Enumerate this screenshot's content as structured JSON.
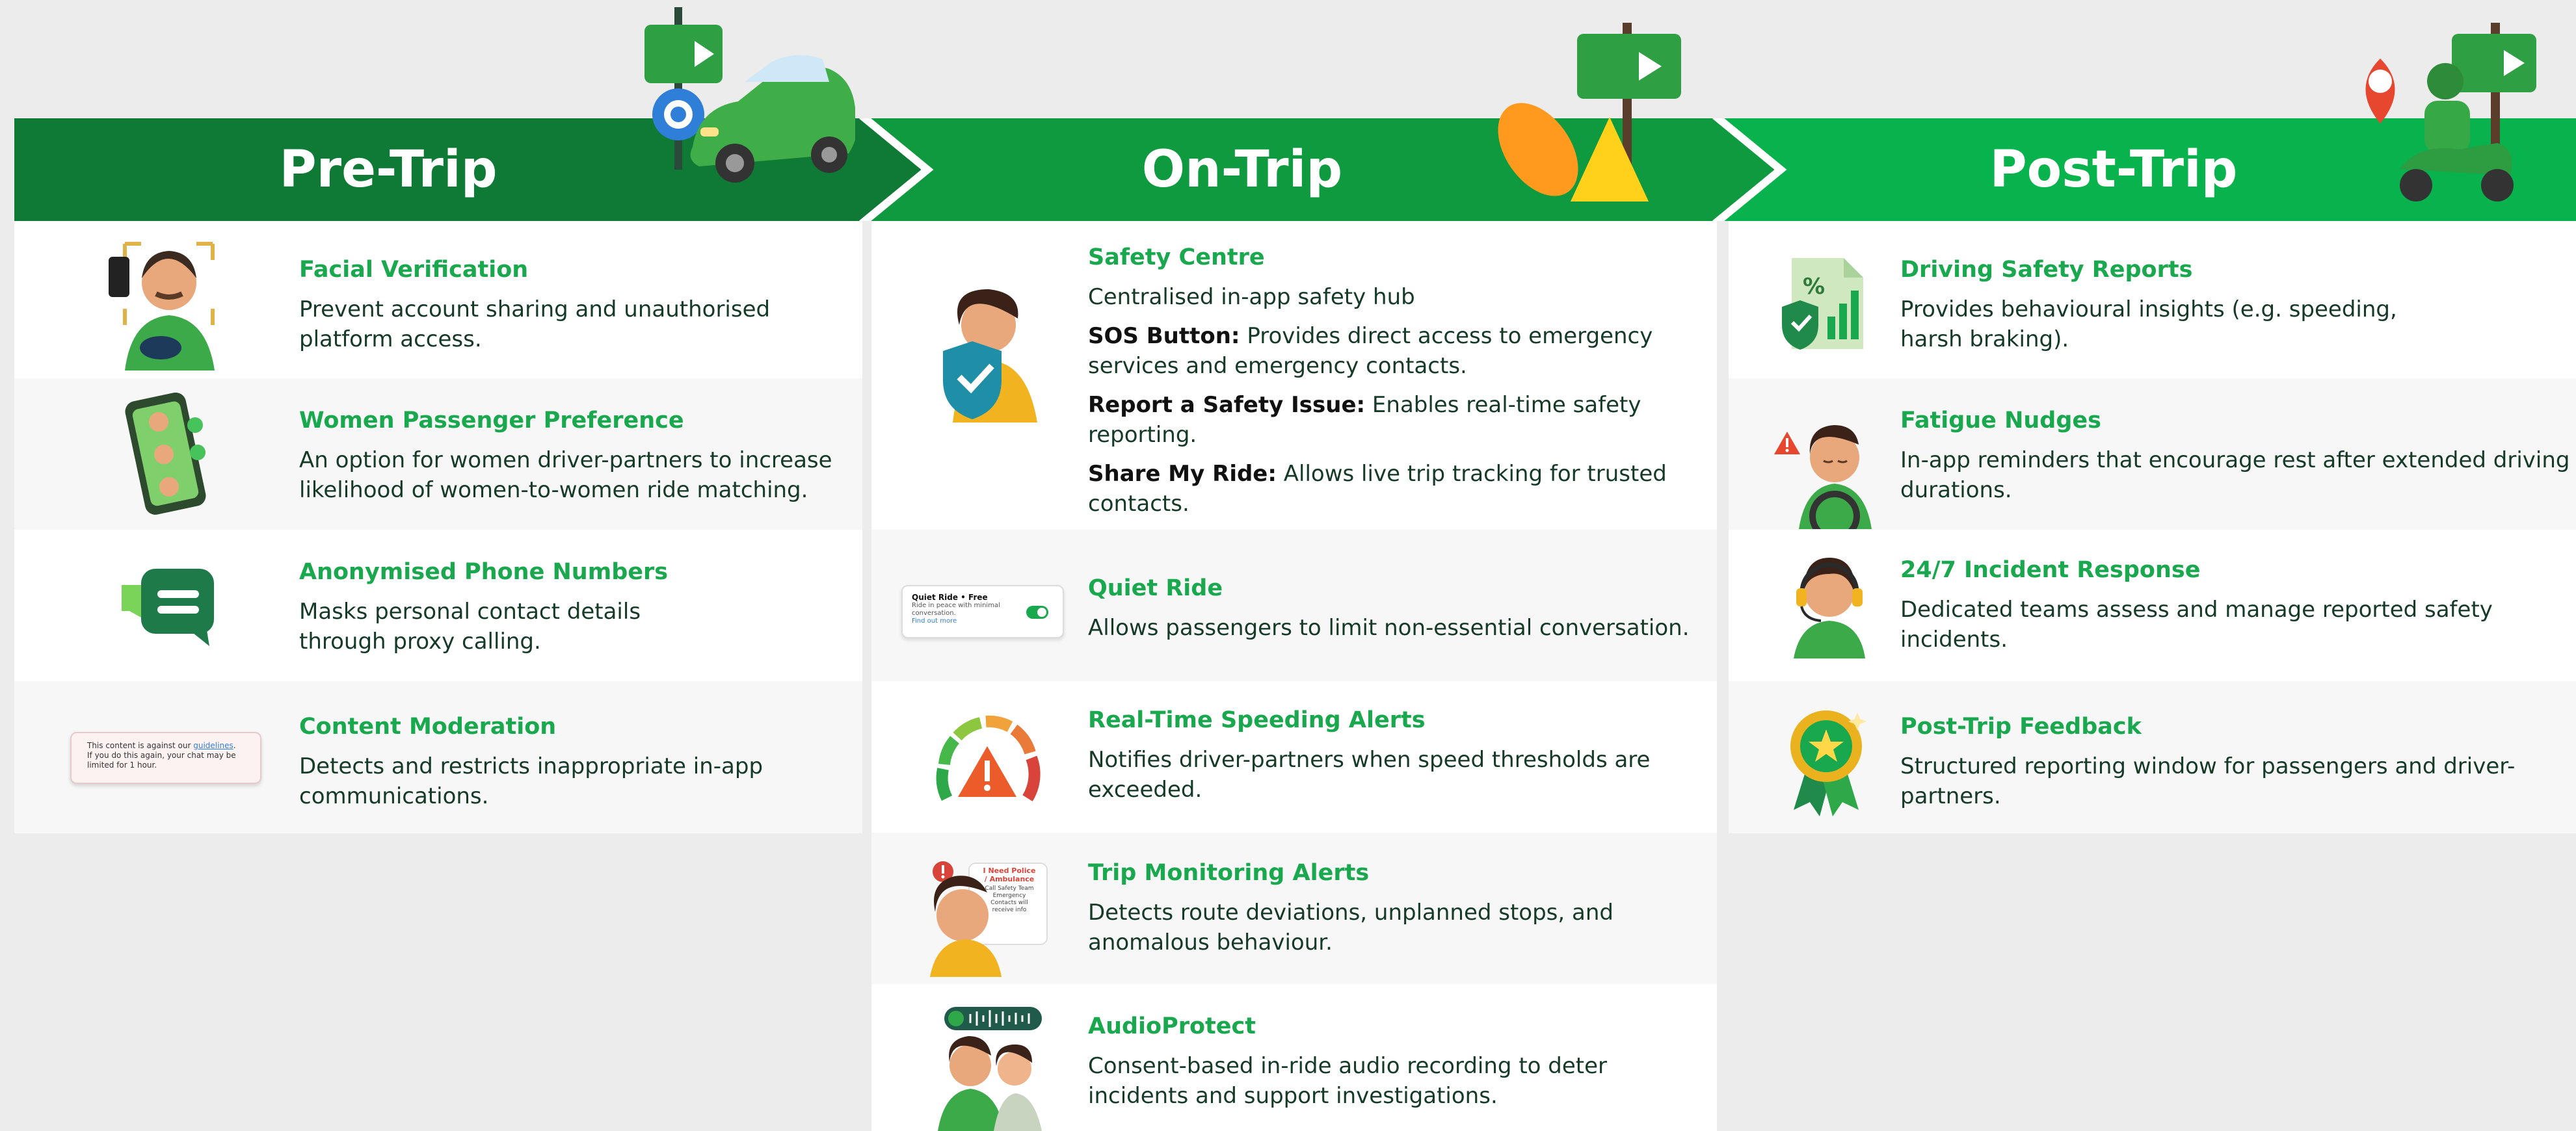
{
  "colors": {
    "pre": "#0e7a35",
    "on": "#0f9a40",
    "post": "#08b24c",
    "title_green": "#1aa84f",
    "text": "#163a28"
  },
  "columns": [
    {
      "title": "Pre-Trip",
      "items": [
        {
          "title": "Facial Verification",
          "lines": [
            "Prevent account sharing and unauthorised",
            "platform access."
          ],
          "icon": "face-scan-person-icon"
        },
        {
          "title": "Women Passenger Preference",
          "lines": [
            "An option for women driver-partners to increase",
            "likelihood of women-to-women ride matching."
          ],
          "icon": "phone-profiles-icon"
        },
        {
          "title": "Anonymised Phone Numbers",
          "lines": [
            "Masks personal contact details",
            "through proxy calling."
          ],
          "icon": "chat-bubble-icon"
        },
        {
          "title": "Content Moderation",
          "lines": [
            "Detects and restricts inappropriate in-app",
            "communications."
          ],
          "icon": "moderation-notice-icon",
          "notice": {
            "line1": "This content is against our ",
            "link": "guidelines",
            "line2": "If you do this again, your chat may be",
            "line3": "limited for 1 hour."
          }
        }
      ]
    },
    {
      "title": "On-Trip",
      "safety": {
        "title": "Safety Centre",
        "intro": "Centralised in-app safety hub",
        "points": [
          {
            "label": "SOS Button:",
            "lines": [
              " Provides direct access to emergency",
              "services and emergency contacts."
            ]
          },
          {
            "label": "Report a Safety Issue:",
            "lines": [
              " Enables real-time safety",
              "reporting."
            ]
          },
          {
            "label": "Share My Ride:",
            "lines": [
              " Allows live trip tracking for trusted",
              "contacts."
            ]
          }
        ]
      },
      "items": [
        {
          "title": "Quiet Ride",
          "lines": [
            "Allows passengers to limit non-essential conversation."
          ],
          "icon": "quiet-ride-toggle-icon",
          "card": {
            "heading": "Quiet Ride • Free",
            "sub": "Ride in peace with minimal",
            "sub2": "conversation.",
            "link": "Find out more"
          }
        },
        {
          "title": "Real-Time Speeding Alerts",
          "lines": [
            "Notifies driver-partners when speed thresholds are",
            "exceeded."
          ],
          "icon": "speedometer-warning-icon"
        },
        {
          "title": "Trip Monitoring Alerts",
          "lines": [
            "Detects route deviations, unplanned stops, and",
            "anomalous behaviour."
          ],
          "icon": "monitoring-alert-icon",
          "card": {
            "line1": "I Need Police",
            "line2": "/ Ambulance",
            "line3": "Call Safety Team",
            "line4": "Emergency",
            "line5": "Contacts will",
            "line6": "receive info"
          }
        },
        {
          "title": "AudioProtect",
          "lines": [
            "Consent-based in-ride audio recording to deter",
            "incidents and support investigations."
          ],
          "icon": "audio-recording-icon"
        }
      ]
    },
    {
      "title": "Post-Trip",
      "items": [
        {
          "title": "Driving Safety Reports",
          "lines": [
            "Provides behavioural insights (e.g. speeding,",
            "harsh braking)."
          ],
          "icon": "report-document-icon"
        },
        {
          "title": "Fatigue Nudges",
          "lines": [
            "In-app reminders that encourage rest after extended driving",
            "durations."
          ],
          "icon": "tired-driver-icon"
        },
        {
          "title": "24/7 Incident Response",
          "lines": [
            "Dedicated teams assess and manage reported safety",
            "incidents."
          ],
          "icon": "support-agent-icon"
        },
        {
          "title": "Post-Trip Feedback",
          "lines": [
            "Structured reporting window for passengers and driver-",
            "partners."
          ],
          "icon": "medal-star-icon"
        }
      ]
    }
  ]
}
